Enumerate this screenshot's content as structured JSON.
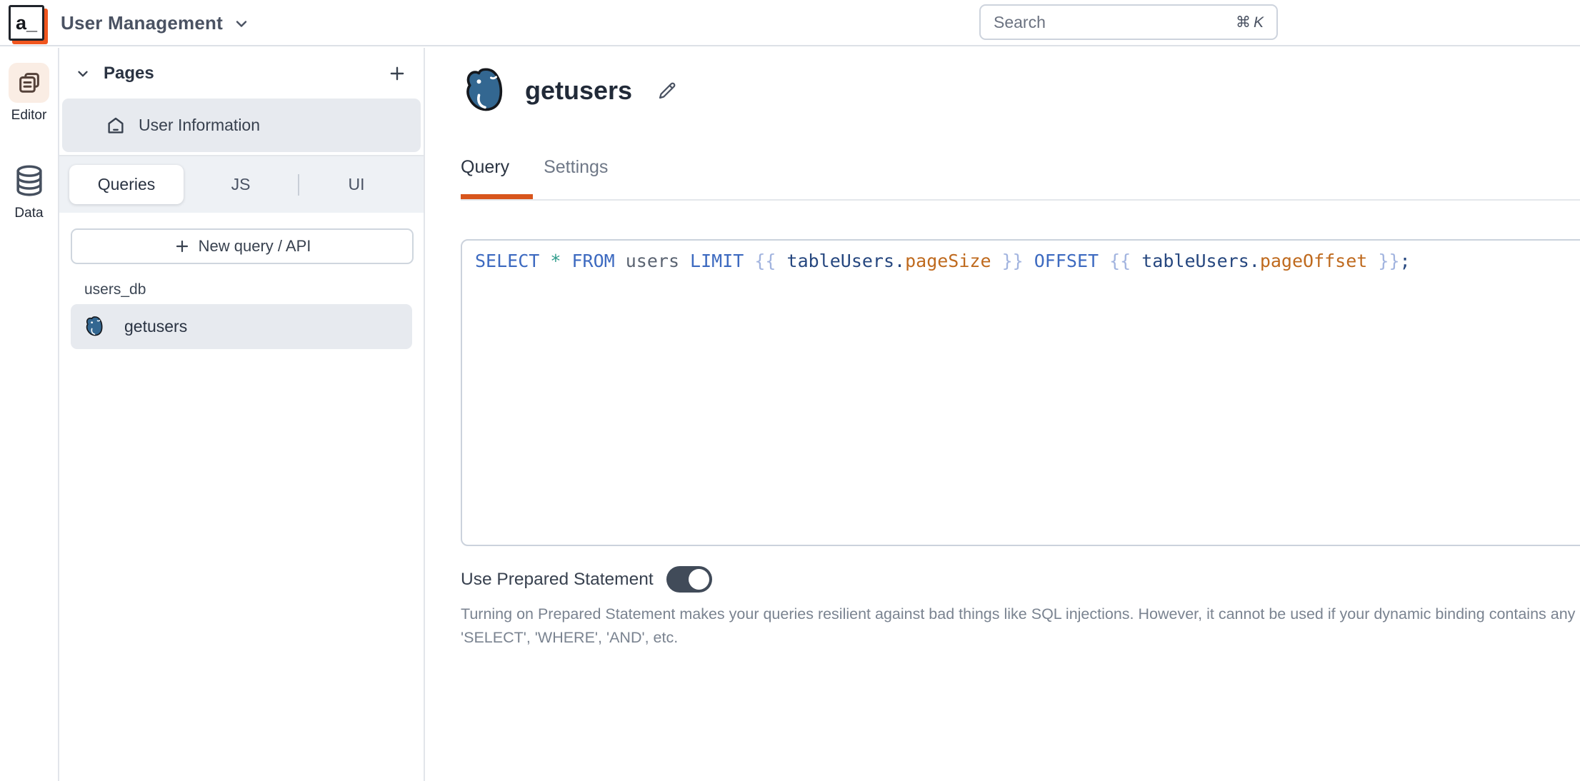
{
  "topbar": {
    "logo_text": "a_",
    "app_title": "User Management",
    "search_placeholder": "Search",
    "search_shortcut_mod": "⌘",
    "search_shortcut_key": "K"
  },
  "left_rail": {
    "items": [
      {
        "label": "Editor",
        "icon": "pages-stack-icon",
        "active": true
      },
      {
        "label": "Data",
        "icon": "database-icon",
        "active": false
      }
    ]
  },
  "pages_panel": {
    "title": "Pages",
    "pages": [
      {
        "label": "User Information",
        "icon": "home-icon",
        "active": true
      }
    ],
    "tabs": [
      {
        "label": "Queries",
        "active": true
      },
      {
        "label": "JS",
        "active": false
      },
      {
        "label": "UI",
        "active": false
      }
    ],
    "new_query_button": "New query / API",
    "datasource_group": "users_db",
    "queries": [
      {
        "label": "getusers",
        "icon": "postgresql-icon",
        "active": true
      }
    ]
  },
  "main": {
    "query_title": "getusers",
    "query_icon": "postgresql-icon",
    "tabs": [
      {
        "label": "Query",
        "active": true
      },
      {
        "label": "Settings",
        "active": false
      }
    ],
    "editor": {
      "language": "sql",
      "sql_text": "SELECT * FROM users LIMIT {{ tableUsers.pageSize }} OFFSET {{ tableUsers.pageOffset }};",
      "tokens": [
        {
          "text": "SELECT ",
          "type": "keyword"
        },
        {
          "text": "* ",
          "type": "operator"
        },
        {
          "text": "FROM ",
          "type": "keyword"
        },
        {
          "text": "users ",
          "type": "name"
        },
        {
          "text": "LIMIT ",
          "type": "keyword"
        },
        {
          "text": "{{ ",
          "type": "brace"
        },
        {
          "text": "tableUsers.",
          "type": "variable"
        },
        {
          "text": "pageSize",
          "type": "property"
        },
        {
          "text": " }} ",
          "type": "brace"
        },
        {
          "text": "OFFSET ",
          "type": "keyword"
        },
        {
          "text": "{{ ",
          "type": "brace"
        },
        {
          "text": "tableUsers.",
          "type": "variable"
        },
        {
          "text": "pageOffset",
          "type": "property"
        },
        {
          "text": " }}",
          "type": "brace"
        },
        {
          "text": ";",
          "type": "variable"
        }
      ]
    },
    "prepared_statement": {
      "label": "Use Prepared Statement",
      "enabled": true,
      "description_line1": "Turning on Prepared Statement makes your queries resilient against bad things like SQL injections. However, it cannot be used if your dynamic binding contains any SQL keywords like",
      "description_line2": "'SELECT', 'WHERE', 'AND', etc."
    }
  },
  "colors": {
    "accent_orange": "#D8551C",
    "logo_shadow_orange": "#F0561F",
    "postgres_blue": "#336791",
    "row_highlight": "#E7EAEF",
    "strip_background": "#EEF1F5",
    "toggle_on": "#414B59",
    "sql_keyword": "#3D6AC0",
    "sql_operator": "#2E9C8B",
    "sql_name": "#5B6472",
    "sql_brace": "#A2B4DF",
    "sql_variable": "#26477F",
    "sql_property": "#BF6A1E"
  }
}
